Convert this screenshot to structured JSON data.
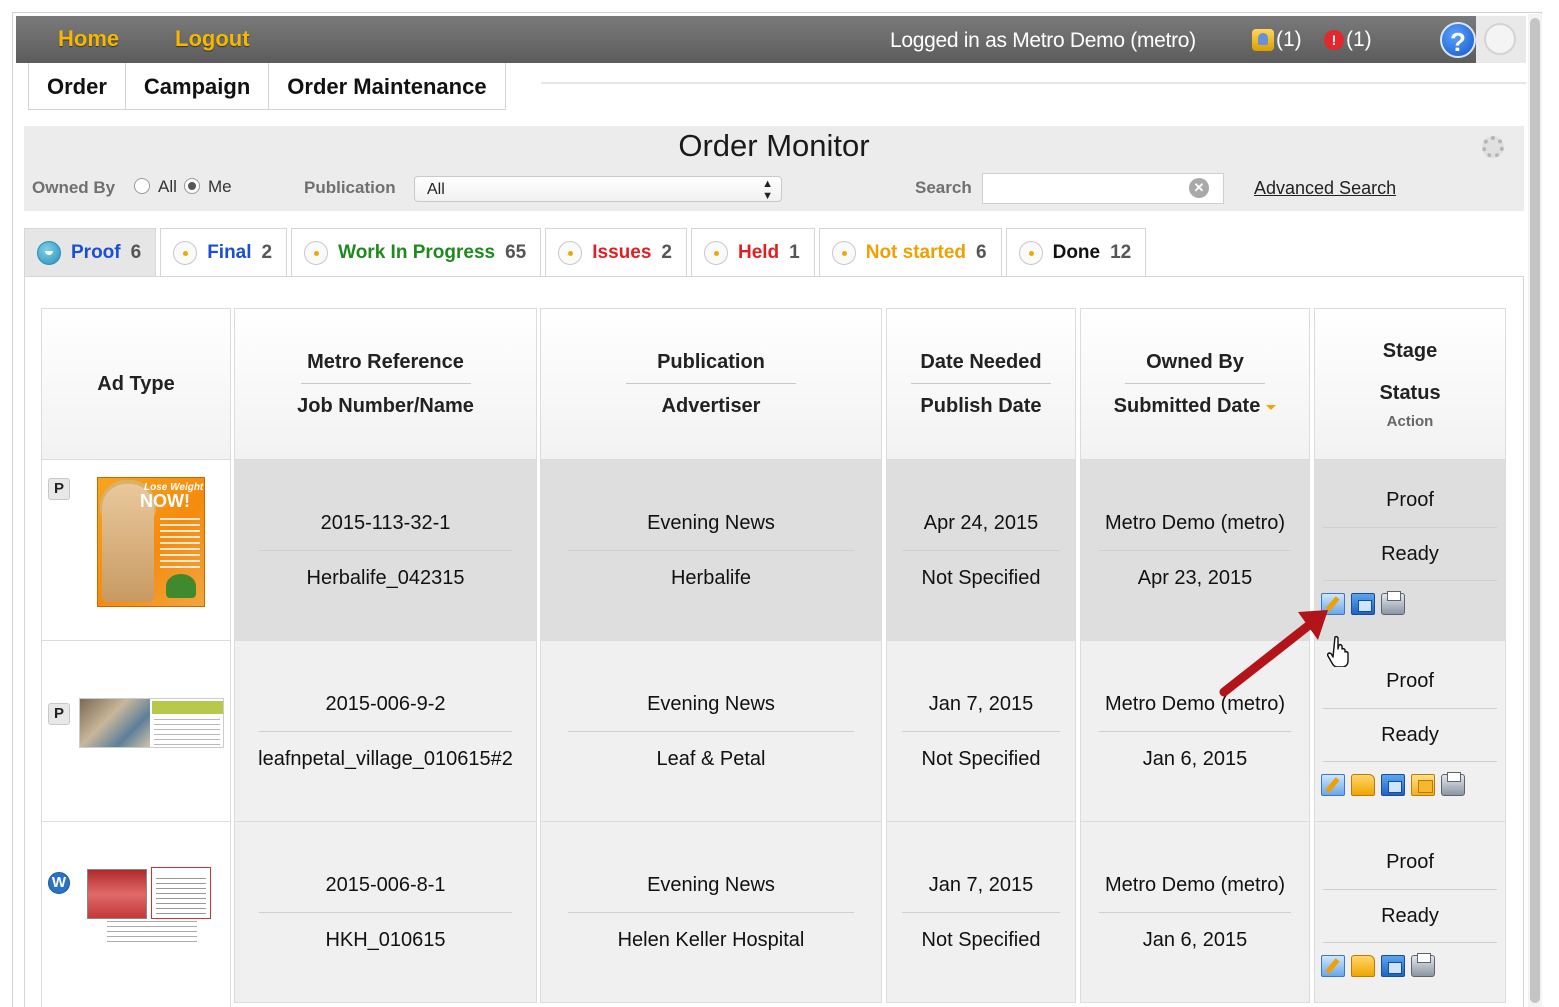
{
  "topbar": {
    "home": "Home",
    "logout": "Logout",
    "logged_in": "Logged in as Metro Demo (metro)",
    "notif_bell_count": "(1)",
    "notif_alert_count": "(1)",
    "help": "?"
  },
  "menu": {
    "tabs": [
      {
        "label": "Order"
      },
      {
        "label": "Campaign"
      },
      {
        "label": "Order Maintenance"
      }
    ]
  },
  "filters": {
    "title": "Order Monitor",
    "owned_by_label": "Owned By",
    "owned_all": "All",
    "owned_me": "Me",
    "owned_selected": "Me",
    "publication_label": "Publication",
    "publication_value": "All",
    "search_label": "Search",
    "search_value": "",
    "advanced_search": "Advanced Search"
  },
  "stage_tabs": [
    {
      "label": "Proof",
      "count": "6",
      "color": "#1a4fd6",
      "active": true
    },
    {
      "label": "Final",
      "count": "2",
      "color": "#1a4fd6",
      "active": false
    },
    {
      "label": "Work In Progress",
      "count": "65",
      "color": "#1e8a1e",
      "active": false
    },
    {
      "label": "Issues",
      "count": "2",
      "color": "#e02020",
      "active": false
    },
    {
      "label": "Held",
      "count": "1",
      "color": "#e02020",
      "active": false
    },
    {
      "label": "Not started",
      "count": "6",
      "color": "#f0a000",
      "active": false
    },
    {
      "label": "Done",
      "count": "12",
      "color": "#111111",
      "active": false
    }
  ],
  "table": {
    "headers": {
      "ad_type": "Ad Type",
      "ref_1": "Metro Reference",
      "ref_2": "Job Number/Name",
      "pub_1": "Publication",
      "pub_2": "Advertiser",
      "date_1": "Date Needed",
      "date_2": "Publish Date",
      "owner_1": "Owned By",
      "owner_2": "Submitted Date",
      "stage_1": "Stage",
      "stage_2": "Status",
      "stage_3": "Action"
    },
    "rows": [
      {
        "type_badge": "P",
        "ref": "2015-113-32-1",
        "job": "Herbalife_042315",
        "publication": "Evening News",
        "advertiser": "Herbalife",
        "date_needed": "Apr 24, 2015",
        "publish_date": "Not Specified",
        "owned_by": "Metro Demo (metro)",
        "submitted": "Apr 23, 2015",
        "stage": "Proof",
        "status": "Ready",
        "thumb_title_1": "Lose Weight",
        "thumb_title_2": "NOW!"
      },
      {
        "type_badge": "P",
        "ref": "2015-006-9-2",
        "job": "leafnpetal_village_010615#2",
        "publication": "Evening News",
        "advertiser": "Leaf & Petal",
        "date_needed": "Jan 7, 2015",
        "publish_date": "Not Specified",
        "owned_by": "Metro Demo (metro)",
        "submitted": "Jan 6, 2015",
        "stage": "Proof",
        "status": "Ready"
      },
      {
        "type_badge": "W",
        "ref": "2015-006-8-1",
        "job": "HKH_010615",
        "publication": "Evening News",
        "advertiser": "Helen Keller Hospital",
        "date_needed": "Jan 7, 2015",
        "publish_date": "Not Specified",
        "owned_by": "Metro Demo (metro)",
        "submitted": "Jan 6, 2015",
        "stage": "Proof",
        "status": "Ready"
      }
    ]
  },
  "colors": {
    "topbar": "#666666",
    "toplink": "#f5b700",
    "annotation_arrow": "#b3141a"
  }
}
